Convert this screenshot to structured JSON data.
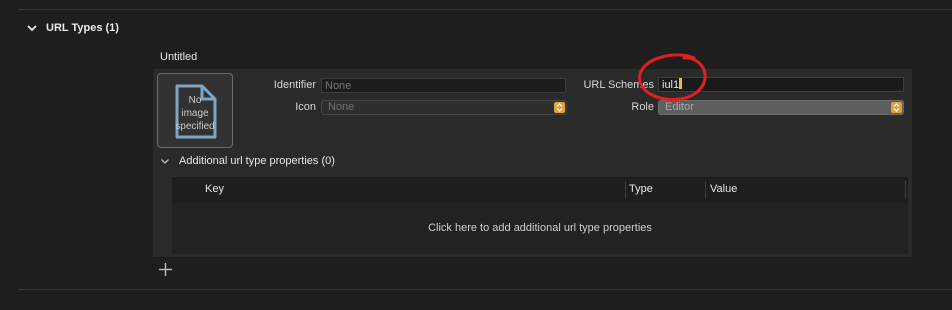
{
  "section": {
    "title": "URL Types (1)"
  },
  "entry": {
    "title": "Untitled",
    "image_placeholder": [
      "No",
      "image",
      "specified"
    ],
    "identifier": {
      "label": "Identifier",
      "value": "",
      "placeholder": "None"
    },
    "icon": {
      "label": "Icon",
      "value": "None"
    },
    "url_schemes": {
      "label": "URL Schemes",
      "value": "iul1"
    },
    "role": {
      "label": "Role",
      "value": "Editor"
    }
  },
  "additional": {
    "title": "Additional url type properties (0)",
    "columns": [
      "Key",
      "Type",
      "Value"
    ],
    "empty_message": "Click here to add additional url type properties"
  },
  "colors": {
    "stepper": "#e3a13a",
    "annotation": "#e02020"
  },
  "icons": [
    "chevron-down-icon",
    "document-icon",
    "popup-stepper-icon",
    "plus-icon"
  ]
}
